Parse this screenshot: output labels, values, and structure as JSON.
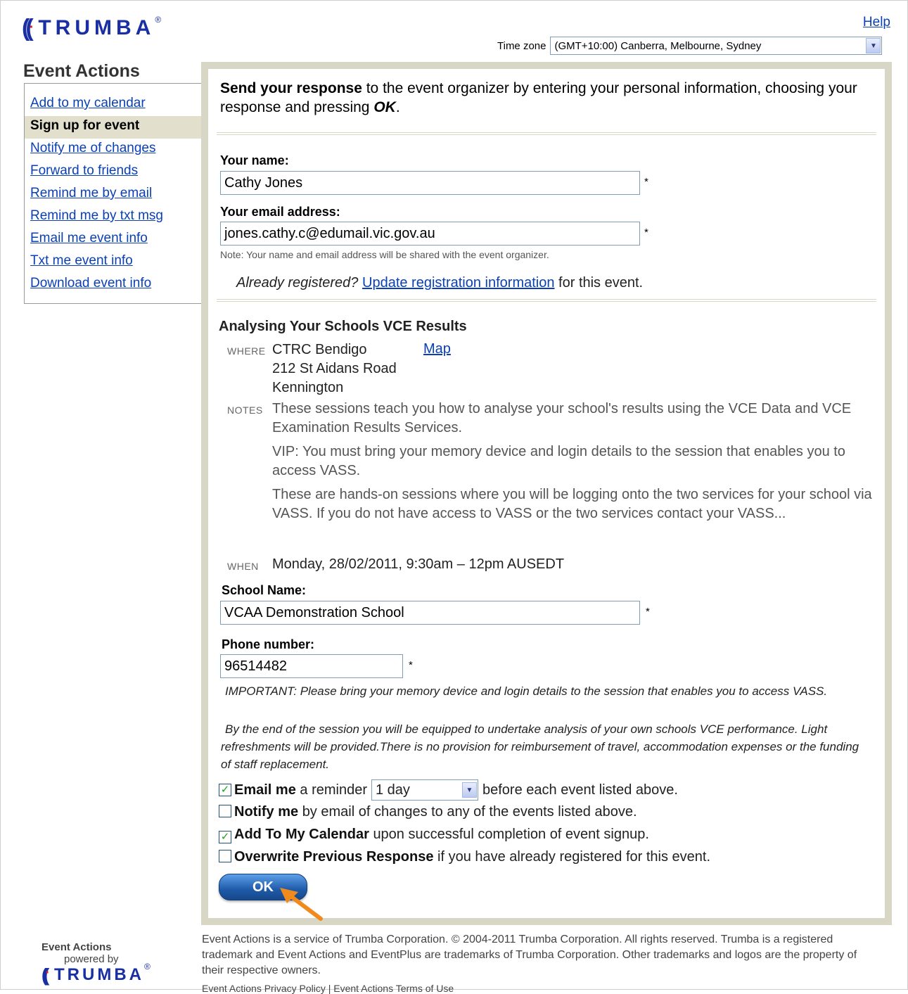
{
  "header": {
    "logo_text": "TRUMBA",
    "help": "Help",
    "timezone_label": "Time zone",
    "timezone_value": "(GMT+10:00) Canberra, Melbourne, Sydney"
  },
  "sidebar": {
    "title": "Event Actions",
    "items": [
      {
        "label": "Add to my calendar"
      },
      {
        "label": "Sign up for event"
      },
      {
        "label": "Notify me of changes"
      },
      {
        "label": "Forward to friends"
      },
      {
        "label": "Remind me by email"
      },
      {
        "label": "Remind me by txt msg"
      },
      {
        "label": "Email me event info"
      },
      {
        "label": "Txt me event info"
      },
      {
        "label": "Download event info"
      }
    ]
  },
  "form": {
    "intro_bold": "Send your response",
    "intro_rest": " to the event organizer by entering your personal information, choosing your response and pressing ",
    "intro_ok": "OK",
    "intro_end": ".",
    "name_label": "Your name:",
    "name_value": "Cathy Jones",
    "email_label": "Your email address:",
    "email_value": "jones.cathy.c@edumail.vic.gov.au",
    "required_mark": "*",
    "share_note": "Note: Your name and email address will be shared with the event organizer.",
    "already_registered": "Already registered?",
    "update_link": "Update registration information",
    "update_suffix": " for this event."
  },
  "event": {
    "title": "Analysing Your Schools VCE Results",
    "where_key": "WHERE",
    "where_lines": [
      "CTRC Bendigo",
      "212 St Aidans Road",
      "Kennington"
    ],
    "map_link": "Map",
    "notes_key": "NOTES",
    "notes": [
      "These sessions teach you how to analyse your school's results using the VCE Data and VCE Examination Results Services.",
      "VIP: You must bring your memory device and login details to the session that enables you to access VASS.",
      "These are hands-on sessions where you will be logging onto the two services for your school via VASS. If you do not have access to VASS or the two services contact your VASS..."
    ],
    "when_key": "WHEN",
    "when": "Monday, 28/02/2011, 9:30am – 12pm AUSEDT"
  },
  "extra": {
    "school_label": "School Name:",
    "school_value": "VCAA Demonstration School",
    "phone_label": "Phone number:",
    "phone_value": "96514482",
    "important_note": "IMPORTANT: Please bring your memory device and login details to the session that enables you to access VASS.",
    "session_note": "By the end of the session you will be equipped to undertake analysis of your own schools VCE performance. Light refreshments will be provided.There is no provision for reimbursement of travel, accommodation expenses or the funding of staff replacement."
  },
  "options": {
    "email_me_bold": "Email me",
    "email_me_mid": "a reminder",
    "reminder_value": "1 day",
    "email_me_end": "before each event listed above.",
    "notify_bold": "Notify me",
    "notify_rest": "by email of changes to any of the events listed above.",
    "calendar_bold": "Add To My Calendar",
    "calendar_rest": "upon successful completion of event signup.",
    "overwrite_bold": "Overwrite Previous Response",
    "overwrite_rest": "if you have already registered for this event.",
    "checked_mark": "✓",
    "ok_label": "OK"
  },
  "footer": {
    "text": "Event Actions is a service of Trumba Corporation. © 2004-2011 Trumba Corporation. All rights reserved. Trumba is a registered trademark and Event Actions and EventPlus are trademarks of Trumba Corporation. Other trademarks and logos are the property of their respective owners.",
    "links": "Event Actions Privacy Policy | Event Actions Terms of Use",
    "powered_1": "Event Actions",
    "powered_2": "powered by",
    "powered_logo": "TRUMBA"
  },
  "colors": {
    "link": "#0b40b5",
    "panel_border": "#d8d6c4",
    "active_item_bg": "#e2e0cd",
    "ok_button": "#1e5aa8",
    "checkbox_check": "#21a121"
  }
}
